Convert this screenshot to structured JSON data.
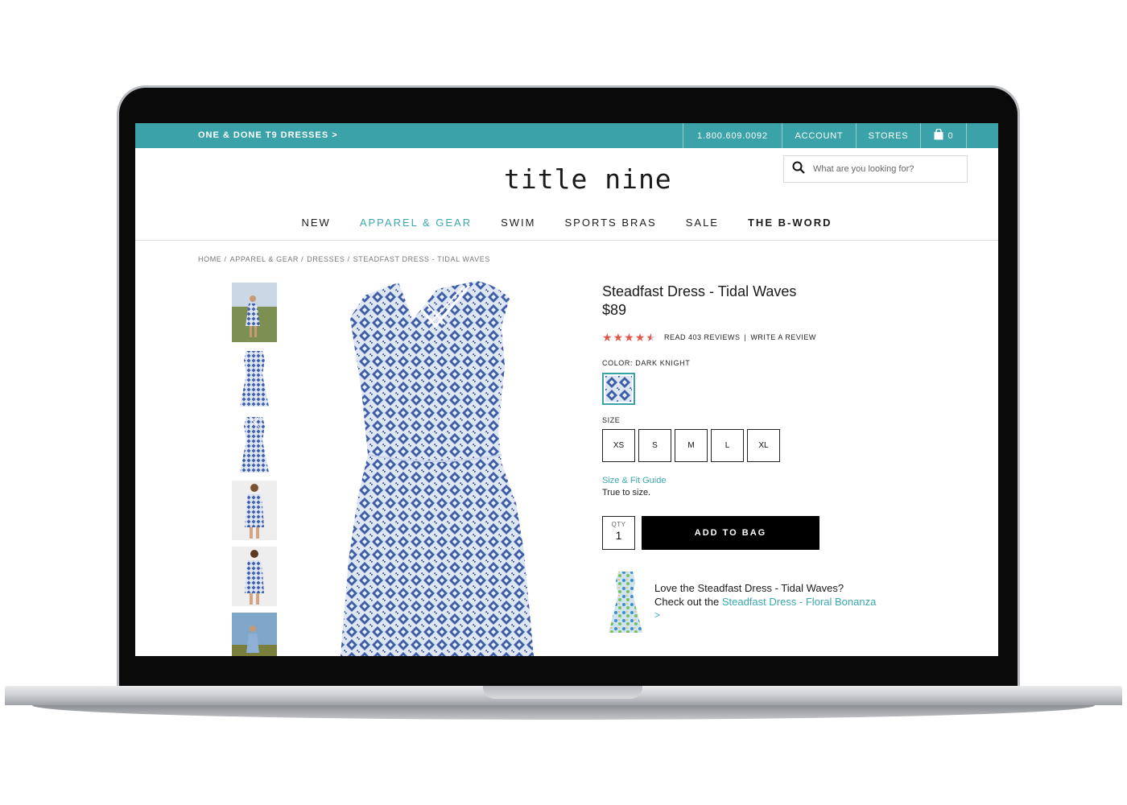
{
  "topbar": {
    "promo": "ONE & DONE T9 DRESSES >",
    "phone": "1.800.609.0092",
    "account": "ACCOUNT",
    "stores": "STORES",
    "bag_count": "0"
  },
  "header": {
    "logo": "title nine",
    "search_placeholder": "What are you looking for?"
  },
  "nav": {
    "items": [
      "NEW",
      "APPAREL & GEAR",
      "SWIM",
      "SPORTS BRAS",
      "SALE",
      "THE B-WORD"
    ],
    "active": "APPAREL & GEAR"
  },
  "breadcrumb": [
    "HOME /",
    "APPAREL & GEAR /",
    "DRESSES /",
    "STEADFAST DRESS - TIDAL WAVES"
  ],
  "product": {
    "title": "Steadfast Dress - Tidal Waves",
    "price": "$89",
    "rating": 4.5,
    "rating_max": 5,
    "read_reviews": "READ 403 REVIEWS",
    "separator": "|",
    "write_review": "WRITE A REVIEW",
    "color_label": "COLOR:",
    "color_value": "DARK KNIGHT",
    "size_label": "SIZE",
    "sizes": [
      "XS",
      "S",
      "M",
      "L",
      "XL"
    ],
    "fit_guide": "Size & Fit Guide",
    "fit_note": "True to size.",
    "qty_label": "QTY",
    "qty_value": "1",
    "add_to_bag": "ADD TO BAG"
  },
  "upsell": {
    "line1": "Love the Steadfast Dress - Tidal Waves?",
    "line2_prefix": "Check out the ",
    "line2_link": "Steadfast Dress - Floral Bonanza",
    "arrow": ">"
  },
  "colors": {
    "accent": "#3aa2a8",
    "link": "#3aa9ae",
    "stars": "#e2574c",
    "dress_blue": "#3f5fa8"
  },
  "icons": {
    "search": "search-icon",
    "bag": "bag-icon",
    "star": "star-icon"
  }
}
